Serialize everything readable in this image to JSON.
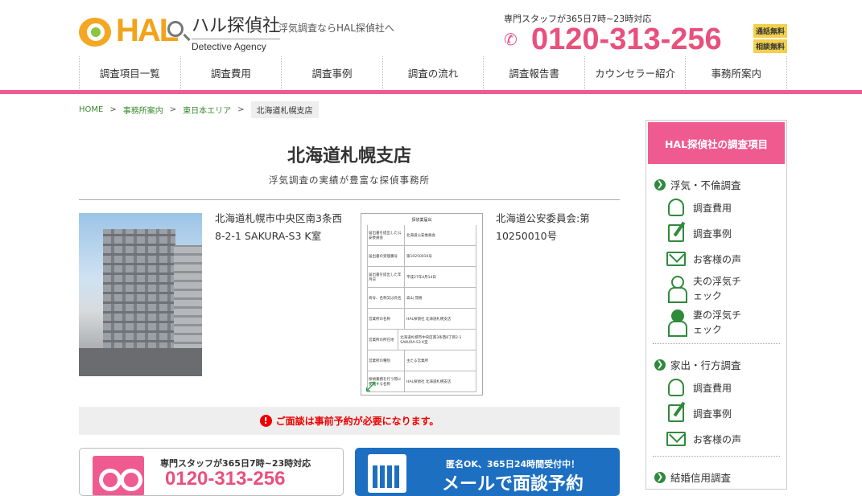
{
  "header": {
    "logo_jp": "ハル探偵社",
    "logo_en": "Detective Agency",
    "logo_mark": "HAL",
    "tagline": "浮気調査ならHAL探偵社へ",
    "staff_note": "専門スタッフが365日7時~23時対応",
    "phone": "0120-313-256",
    "badges": [
      "通話無料",
      "相談無料"
    ]
  },
  "nav": [
    "調査項目一覧",
    "調査費用",
    "調査事例",
    "調査の流れ",
    "調査報告書",
    "カウンセラー紹介",
    "事務所案内"
  ],
  "breadcrumb": {
    "home": "HOME",
    "sep": ">",
    "items": [
      "事務所案内",
      "東日本エリア"
    ],
    "current": "北海道札幌支店"
  },
  "main": {
    "title": "北海道札幌支店",
    "subtitle": "浮気調査の実績が豊富な探偵事務所",
    "address": "北海道札幌市中央区南3条西8-2-1 SAKURA-S3 K室",
    "license": "北海道公安委員会:第10250010号",
    "doc": {
      "title": "探偵業届出",
      "rows": [
        {
          "k": "届出書を提出した公安委員会",
          "v": "北海道公安委員会"
        },
        {
          "k": "届出書の受理番号",
          "v": "第10250010号"
        },
        {
          "k": "届出書を提出した年月日",
          "v": "平成27年4月14日"
        },
        {
          "k": "商号、名称又は氏名",
          "v": "高山 茂樹"
        },
        {
          "k": "営業所の名称",
          "v": "HAL探偵社 北海道札幌支店"
        },
        {
          "k": "営業所の所在地",
          "v": "北海道札幌市中央区南3条西8丁目2-1 SAKURA-S3 K室"
        },
        {
          "k": "営業所の種別",
          "v": "主たる営業所"
        },
        {
          "k": "探偵業務を行う際に使用する名称",
          "v": "HAL探偵社 北海道札幌支店"
        }
      ]
    },
    "notice": "ご面談は事前予約が必要になります。",
    "cta_phone": {
      "sub": "専門スタッフが365日7時~23時対応",
      "phone": "0120-313-256"
    },
    "cta_mail": {
      "sub": "匿名OK、365日24時間受付中！",
      "main": "メールで面談予約"
    }
  },
  "sidebar": {
    "heading": "HAL探偵社の調査項目",
    "sections": [
      {
        "title": "浮気・不倫調査",
        "items": [
          "調査費用",
          "調査事例",
          "お客様の声",
          "夫の浮気チェック",
          "妻の浮気チェック"
        ]
      },
      {
        "title": "家出・行方調査",
        "items": [
          "調査費用",
          "調査事例",
          "お客様の声"
        ]
      },
      {
        "title": "結婚信用調査",
        "items": []
      }
    ]
  },
  "colors": {
    "accent": "#ef5b8f",
    "link": "#3a8a30",
    "icon": "#2f8a3c",
    "mail": "#1d6fc1"
  }
}
